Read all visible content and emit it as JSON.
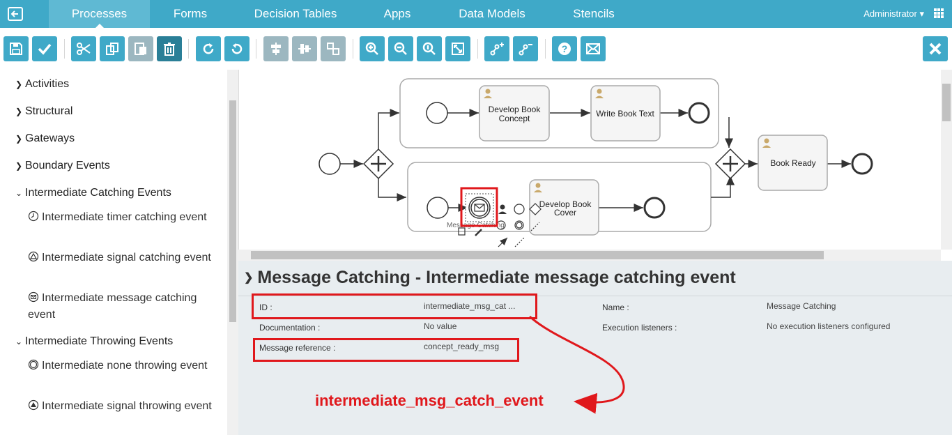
{
  "nav": {
    "items": [
      "Processes",
      "Forms",
      "Decision Tables",
      "Apps",
      "Data Models",
      "Stencils"
    ],
    "active": "Processes",
    "user": "Administrator",
    "back_icon": "back-icon",
    "menu_icon": "grid-menu-icon"
  },
  "toolbar": {
    "buttons": [
      "save-icon",
      "validate-icon",
      "cut-icon",
      "copy-icon",
      "paste-icon",
      "delete-icon",
      "redo-icon",
      "undo-icon",
      "align-horizontal-icon",
      "align-vertical-icon",
      "same-size-icon",
      "zoom-in-icon",
      "zoom-out-icon",
      "zoom-actual-icon",
      "fit-icon",
      "add-bendpoint-icon",
      "remove-bendpoint-icon",
      "help-icon",
      "feedback-mail-icon",
      "close-icon"
    ]
  },
  "palette": {
    "groups": [
      "Activities",
      "Structural",
      "Gateways",
      "Boundary Events",
      "Intermediate Catching Events"
    ],
    "catching_items": [
      "Intermediate timer catching event",
      "Intermediate signal catching event",
      "Intermediate message catching event"
    ],
    "throwing_group": "Intermediate Throwing Events",
    "throwing_items": [
      "Intermediate none throwing event",
      "Intermediate signal throwing event"
    ]
  },
  "diagram": {
    "tasks": [
      "Develop Book Concept",
      "Write Book Text",
      "Develop Book Cover",
      "Book Ready"
    ],
    "selected_label_partial": "Message Catching"
  },
  "properties": {
    "title": "Message Catching - Intermediate message catching event",
    "id_label": "ID :",
    "id_value": "intermediate_msg_cat ...",
    "doc_label": "Documentation :",
    "doc_value": "No value",
    "msgref_label": "Message reference :",
    "msgref_value": "concept_ready_msg",
    "name_label": "Name :",
    "name_value": "Message Catching",
    "exec_label": "Execution listeners :",
    "exec_value": "No execution listeners configured"
  },
  "annotation": "intermediate_msg_catch_event",
  "colors": {
    "accent": "#3fa9c8",
    "highlight": "#e0181c"
  }
}
